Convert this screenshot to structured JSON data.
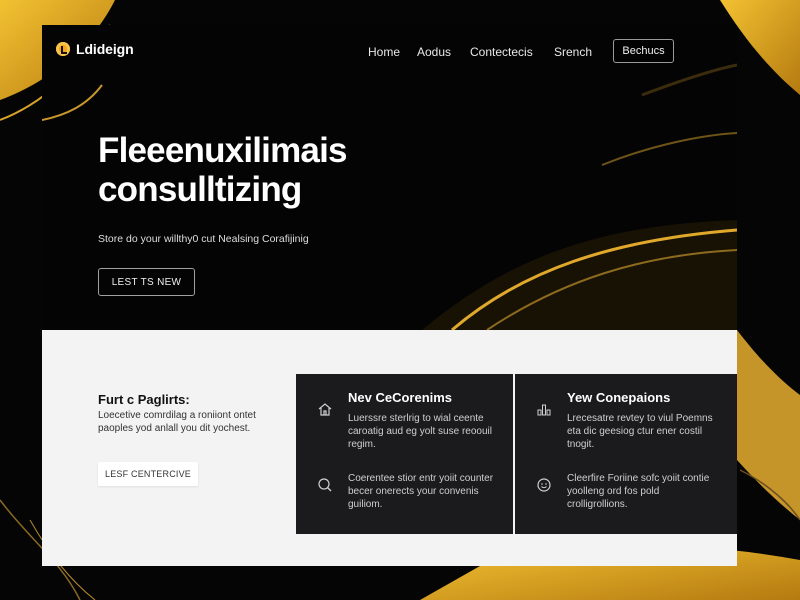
{
  "brand": {
    "logo_text": "Ldideign",
    "accent": "#f0a51d"
  },
  "nav": {
    "links": [
      "Home",
      "Aodus",
      "Contectecis",
      "Srench"
    ],
    "cta": "Bechucs"
  },
  "hero": {
    "title_line1": "Fleeenuxilimais",
    "title_line2": "consulltizing",
    "subtitle": "Store do your willthy0 cut Nealsing Corafijinig",
    "cta": "LEST TS NEW"
  },
  "feature_intro": {
    "title": "Furt c Paglirts:",
    "desc": "Loecetive comrdilag a roniiont ontet paoples yod anlall you dit yochest.",
    "cta": "LESF CENTERCIVE"
  },
  "cards": [
    {
      "heading": "Nev CeCorenims",
      "items": [
        {
          "icon": "house-icon",
          "text": "Luerssre sterlrig to wial ceente caroatig aud eg yolt suse reoouil regim."
        },
        {
          "icon": "search-icon",
          "text": "Coerentee stior entr yoiit counter becer onerects your convenis guiliom."
        }
      ]
    },
    {
      "heading": "Yew Conepaions",
      "items": [
        {
          "icon": "chart-icon",
          "text": "Lrecesatre revtey to viul Poemns eta dic geesiog ctur ener costil tnogit."
        },
        {
          "icon": "smile-icon",
          "text": "Cleerfire Foriine sofc yoiit contie yoolleng ord fos pold crolligrollions."
        }
      ]
    }
  ]
}
